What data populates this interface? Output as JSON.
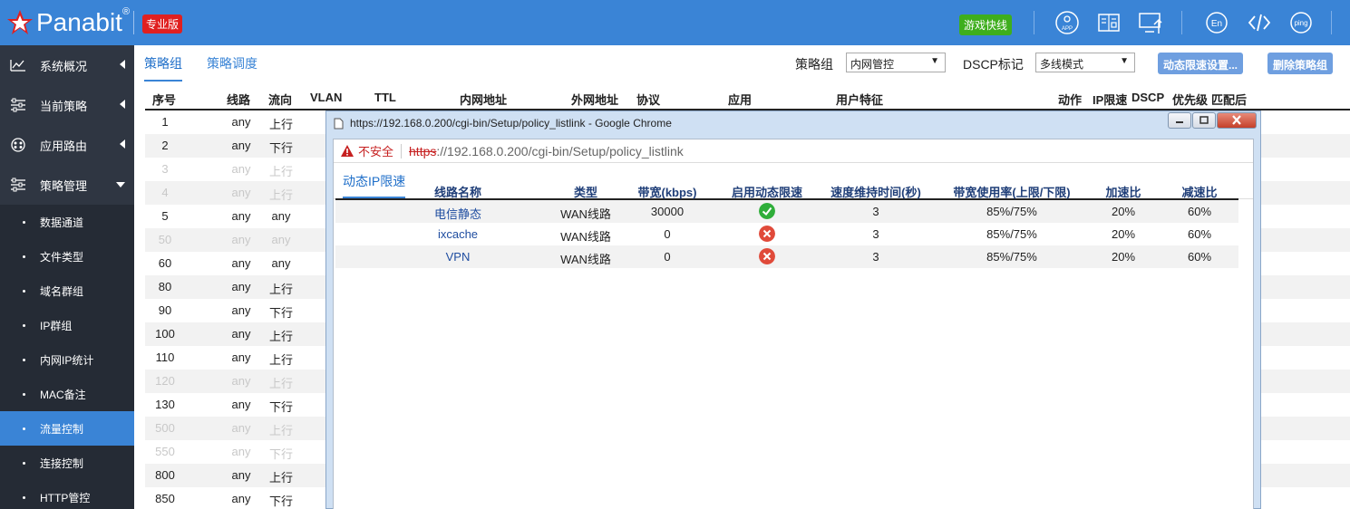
{
  "header": {
    "brand": "Panabit",
    "brand_reg": "®",
    "edition_badge": "专业版",
    "game_badge": "游戏快线",
    "icons": [
      "app-icon",
      "report-icon",
      "monitor-upload-icon",
      "language-en-icon",
      "code-icon",
      "ping-icon"
    ],
    "en_label": "En",
    "ping_label": "ping",
    "app_label": "APP"
  },
  "sidebar": {
    "main": [
      {
        "label": "系统概况",
        "icon": "line-chart-icon",
        "arrow": "left"
      },
      {
        "label": "当前策略",
        "icon": "sliders-icon",
        "arrow": "left"
      },
      {
        "label": "应用路由",
        "icon": "router-icon",
        "arrow": "left"
      },
      {
        "label": "策略管理",
        "icon": "sliders-icon",
        "arrow": "down"
      }
    ],
    "sub": [
      {
        "label": "数据通道"
      },
      {
        "label": "文件类型"
      },
      {
        "label": "域名群组"
      },
      {
        "label": "IP群组"
      },
      {
        "label": "内网IP统计"
      },
      {
        "label": "MAC备注"
      },
      {
        "label": "流量控制",
        "active": true
      },
      {
        "label": "连接控制"
      },
      {
        "label": "HTTP管控"
      }
    ]
  },
  "tabs": {
    "group": "策略组",
    "schedule": "策略调度",
    "group_label": "策略组",
    "group_value": "内网管控",
    "dscp_label": "DSCP标记",
    "dscp_value": "多线模式",
    "btn_dynamic": "动态限速设置...",
    "btn_delete": "删除策略组"
  },
  "main_table": {
    "headers": [
      "序号",
      "线路",
      "流向",
      "VLAN",
      "TTL",
      "内网地址",
      "外网地址",
      "协议",
      "应用",
      "用户特征",
      "动作",
      "IP限速",
      "DSCP",
      "优先级",
      "匹配后"
    ],
    "rows": [
      {
        "id": "1",
        "line": "any",
        "dir": "上行",
        "dim": false
      },
      {
        "id": "2",
        "line": "any",
        "dir": "下行",
        "dim": false
      },
      {
        "id": "3",
        "line": "any",
        "dir": "上行",
        "dim": true
      },
      {
        "id": "4",
        "line": "any",
        "dir": "上行",
        "dim": true
      },
      {
        "id": "5",
        "line": "any",
        "dir": "any",
        "dim": false
      },
      {
        "id": "50",
        "line": "any",
        "dir": "any",
        "dim": true
      },
      {
        "id": "60",
        "line": "any",
        "dir": "any",
        "dim": false
      },
      {
        "id": "80",
        "line": "any",
        "dir": "上行",
        "dim": false
      },
      {
        "id": "90",
        "line": "any",
        "dir": "下行",
        "dim": false
      },
      {
        "id": "100",
        "line": "any",
        "dir": "上行",
        "dim": false
      },
      {
        "id": "110",
        "line": "any",
        "dir": "上行",
        "dim": false
      },
      {
        "id": "120",
        "line": "any",
        "dir": "上行",
        "dim": true
      },
      {
        "id": "130",
        "line": "any",
        "dir": "下行",
        "dim": false
      },
      {
        "id": "500",
        "line": "any",
        "dir": "上行",
        "dim": true
      },
      {
        "id": "550",
        "line": "any",
        "dir": "下行",
        "dim": true
      },
      {
        "id": "800",
        "line": "any",
        "dir": "上行",
        "dim": false
      },
      {
        "id": "850",
        "line": "any",
        "dir": "下行",
        "dim": false
      }
    ]
  },
  "popup": {
    "window_title": "https://192.168.0.200/cgi-bin/Setup/policy_listlink - Google Chrome",
    "insecure": "不安全",
    "url_scheme": "https",
    "url_rest": "://192.168.0.200/cgi-bin/Setup/policy_listlink",
    "tab": "动态IP限速",
    "headers": [
      "线路名称",
      "类型",
      "带宽(kbps)",
      "启用动态限速",
      "速度维持时间(秒)",
      "带宽使用率(上限/下限)",
      "加速比",
      "减速比"
    ],
    "rows": [
      {
        "name": "电信静态",
        "type": "WAN线路",
        "bw": "30000",
        "enabled": true,
        "hold": "3",
        "usage": "85%/75%",
        "up": "20%",
        "down": "60%"
      },
      {
        "name": "ixcache",
        "type": "WAN线路",
        "bw": "0",
        "enabled": false,
        "hold": "3",
        "usage": "85%/75%",
        "up": "20%",
        "down": "60%"
      },
      {
        "name": "VPN",
        "type": "WAN线路",
        "bw": "0",
        "enabled": false,
        "hold": "3",
        "usage": "85%/75%",
        "up": "20%",
        "down": "60%"
      }
    ]
  },
  "colors": {
    "primary": "#3a84d6",
    "sidebar": "#2f3642",
    "enabled": "#2fae3a",
    "disabled": "#e04a3a"
  }
}
